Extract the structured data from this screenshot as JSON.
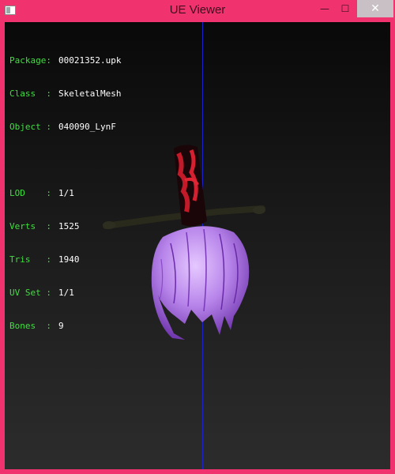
{
  "window": {
    "title": "UE Viewer"
  },
  "titlebar": {
    "minimize_glyph": "—",
    "maximize_glyph": "☐",
    "close_glyph": "✕"
  },
  "info": {
    "package": {
      "label": "Package:",
      "value": "00021352.upk"
    },
    "class": {
      "label": "Class  :",
      "value": "SkeletalMesh"
    },
    "object": {
      "label": "Object :",
      "value": "040090_LynF"
    },
    "lod": {
      "label": "LOD    :",
      "value": "1/1"
    },
    "verts": {
      "label": "Verts  :",
      "value": "1525"
    },
    "tris": {
      "label": "Tris   :",
      "value": "1940"
    },
    "uvset": {
      "label": "UV Set :",
      "value": "1/1"
    },
    "bones": {
      "label": "Bones  :",
      "value": "9"
    }
  },
  "colors": {
    "frame": "#f0336e",
    "label_text": "#3ee03e",
    "value_text": "#ffffff",
    "axis": "#1a22c8",
    "hair": "#b080e0"
  }
}
